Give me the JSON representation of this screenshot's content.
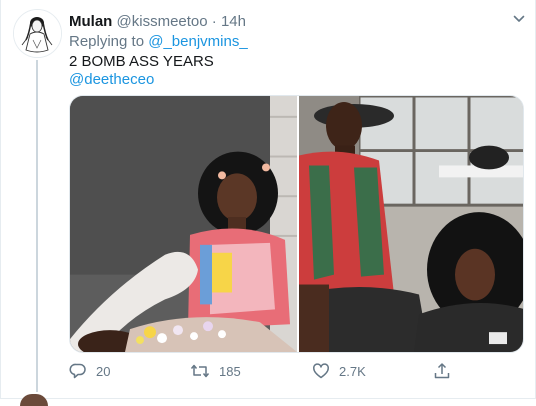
{
  "tweet": {
    "author_name": "Mulan",
    "handle": "@kissmeetoo",
    "separator": "·",
    "time": "14h",
    "replying_prefix": "Replying to",
    "replying_to": "@_benjvmins_",
    "text": "2 BOMB ASS YEARS",
    "mention": "@deetheceo"
  },
  "actions": {
    "reply_icon": "reply-icon",
    "reply_count": "20",
    "retweet_icon": "retweet-icon",
    "retweet_count": "185",
    "like_icon": "heart-icon",
    "like_count": "2.7K",
    "share_icon": "share-icon"
  },
  "colors": {
    "link": "#1b95e0",
    "muted": "#657786",
    "text": "#14171a",
    "thread_line": "#ccd6dd"
  }
}
